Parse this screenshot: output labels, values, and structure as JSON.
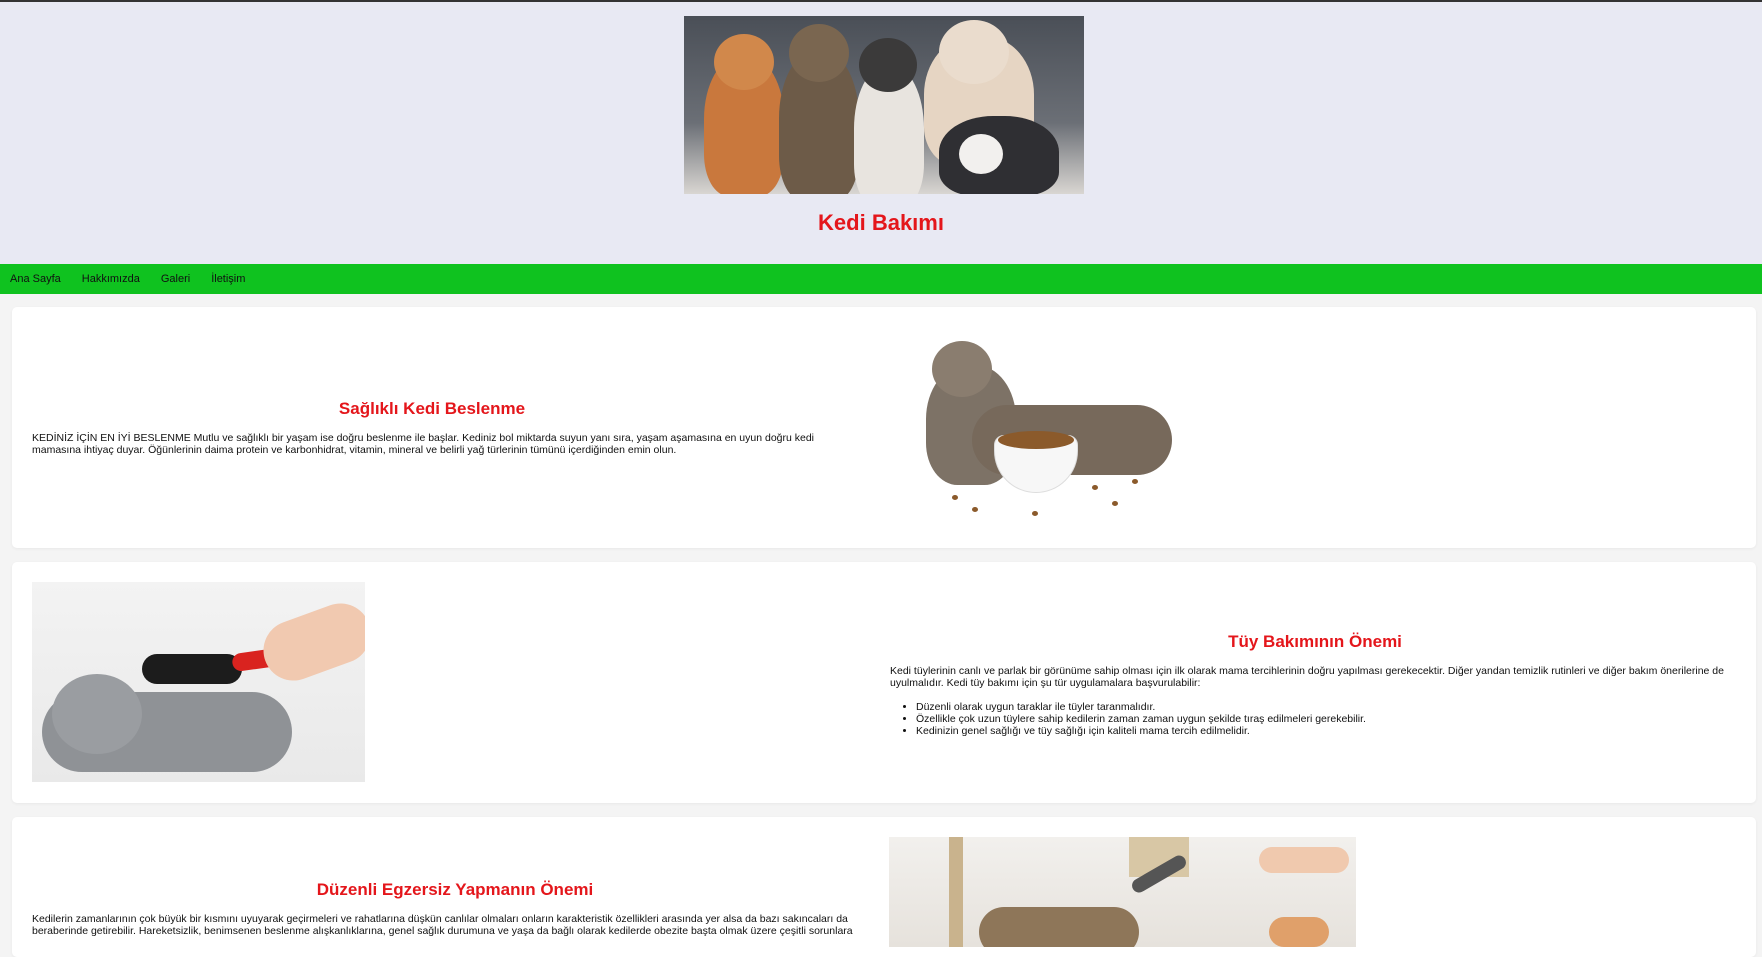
{
  "header": {
    "title": "Kedi Bakımı"
  },
  "nav": {
    "items": [
      "Ana Sayfa",
      "Hakkımızda",
      "Galeri",
      "İletişim"
    ]
  },
  "sections": [
    {
      "title": "Sağlıklı Kedi Beslenme",
      "text": "KEDİNİZ İÇİN EN İYİ BESLENME Mutlu ve sağlıklı bir yaşam ise doğru beslenme ile başlar. Kediniz bol miktarda suyun yanı sıra, yaşam aşamasına en uyun doğru kedi mamasına ihtiyaç duyar. Öğünlerinin daima protein ve karbonhidrat, vitamin, mineral ve belirli yağ türlerinin tümünü içerdiğinden emin olun."
    },
    {
      "title": "Tüy Bakımının Önemi",
      "text": "Kedi tüylerinin canlı ve parlak bir görünüme sahip olması için ilk olarak mama tercihlerinin doğru yapılması gerekecektir. Diğer yandan temizlik rutinleri ve diğer bakım önerilerine de uyulmalıdır. Kedi tüy bakımı için şu tür uygulamalara başvurulabilir:",
      "list": [
        "Düzenli olarak uygun taraklar ile tüyler taranmalıdır.",
        "Özellikle çok uzun tüylere sahip kedilerin zaman zaman uygun şekilde tıraş edilmeleri gerekebilir.",
        "Kedinizin genel sağlığı ve tüy sağlığı için kaliteli mama tercih edilmelidir."
      ]
    },
    {
      "title": "Düzenli Egzersiz Yapmanın Önemi",
      "text": "Kedilerin zamanlarının çok büyük bir kısmını uyuyarak geçirmeleri ve rahatlarına düşkün canlılar olmaları onların karakteristik özellikleri arasında yer alsa da bazı sakıncaları da beraberinde getirebilir. Hareketsizlik, benimsenen beslenme alışkanlıklarına, genel sağlık durumuna ve yaşa da bağlı olarak kedilerde obezite başta olmak üzere çeşitli sorunlara"
    }
  ],
  "colors": {
    "accent": "#e4161b",
    "nav": "#0fc21f",
    "header_bg": "#e8e9f3"
  }
}
